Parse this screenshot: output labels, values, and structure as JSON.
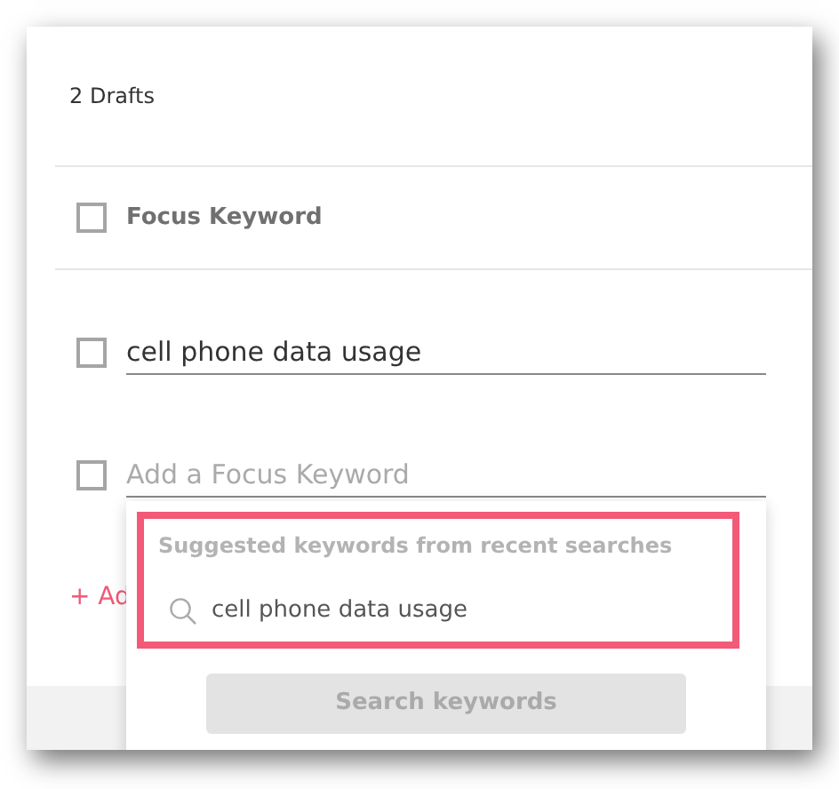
{
  "drafts_count": "2 Drafts",
  "keywords": [
    {
      "kind": "header",
      "label": "Focus Keyword",
      "checked": false
    },
    {
      "kind": "value",
      "value": "cell phone data usage",
      "checked": false
    },
    {
      "kind": "empty",
      "placeholder": "Add a Focus Keyword",
      "checked": false
    }
  ],
  "add_link": "+ Ad",
  "suggestions": {
    "heading": "Suggested keywords from recent searches",
    "highlighted": true,
    "items": [
      {
        "text": "cell phone data usage"
      }
    ]
  },
  "search_button": {
    "label": "Search keywords",
    "disabled": true
  }
}
